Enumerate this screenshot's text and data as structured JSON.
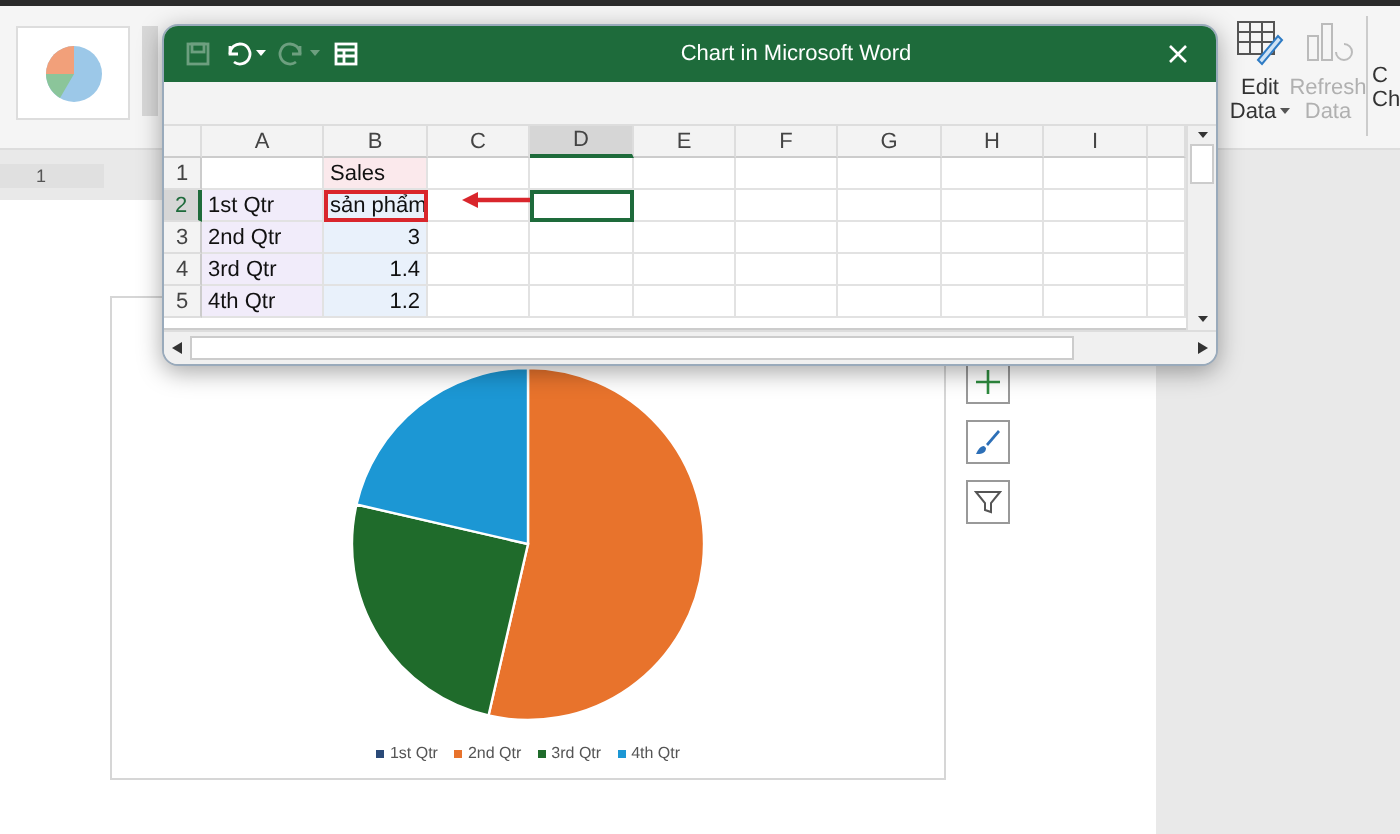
{
  "ribbon": {
    "buttons": [
      {
        "kind": "edit",
        "lines": [
          "Edit",
          "Data"
        ],
        "menu": true,
        "disabled": false
      },
      {
        "kind": "refresh",
        "lines": [
          "Refresh",
          "Data"
        ],
        "menu": false,
        "disabled": true
      },
      {
        "kind": "cut",
        "lines": [
          "C",
          "Ch"
        ],
        "menu": false,
        "disabled": false
      }
    ]
  },
  "ruler": {
    "mark": "1"
  },
  "excel": {
    "title": "Chart in Microsoft Word",
    "quick_access": [
      {
        "kind": "save",
        "disabled": true
      },
      {
        "kind": "undo",
        "disabled": false
      },
      {
        "kind": "redo",
        "disabled": true
      },
      {
        "kind": "table",
        "disabled": false
      }
    ],
    "columns": [
      {
        "label": "A",
        "selected": false
      },
      {
        "label": "B",
        "selected": false
      },
      {
        "label": "C",
        "selected": false
      },
      {
        "label": "D",
        "selected": true
      },
      {
        "label": "E",
        "selected": false
      },
      {
        "label": "F",
        "selected": false
      },
      {
        "label": "G",
        "selected": false
      },
      {
        "label": "H",
        "selected": false
      },
      {
        "label": "I",
        "selected": false
      }
    ],
    "rows": [
      {
        "number": "1",
        "active": false,
        "cells": [
          null,
          {
            "text": "Sales",
            "kind": "text",
            "marked": false
          }
        ]
      },
      {
        "number": "2",
        "active": true,
        "cells": [
          {
            "text": "1st Qtr",
            "kind": "text",
            "marked": false
          },
          {
            "text": "sản phẩm",
            "kind": "text",
            "marked": true
          }
        ]
      },
      {
        "number": "3",
        "active": false,
        "cells": [
          {
            "text": "2nd Qtr",
            "kind": "text",
            "marked": false
          },
          {
            "text": "3",
            "kind": "number",
            "marked": false
          }
        ]
      },
      {
        "number": "4",
        "active": false,
        "cells": [
          {
            "text": "3rd Qtr",
            "kind": "text",
            "marked": false
          },
          {
            "text": "1.4",
            "kind": "number",
            "marked": false
          }
        ]
      },
      {
        "number": "5",
        "active": false,
        "cells": [
          {
            "text": "4th Qtr",
            "kind": "text",
            "marked": false
          },
          {
            "text": "1.2",
            "kind": "number",
            "marked": false
          }
        ]
      }
    ]
  },
  "chart": {
    "chart_data": {
      "type": "pie",
      "categories": [
        "1st Qtr",
        "2nd Qtr",
        "3rd Qtr",
        "4th Qtr"
      ],
      "values": [
        0,
        53.6,
        25,
        21.4
      ]
    },
    "slices": [
      {
        "color": "#2a4a78"
      },
      {
        "color": "#e8732c"
      },
      {
        "color": "#1f6b2b"
      },
      {
        "color": "#1c97d4"
      }
    ],
    "tools": [
      {
        "kind": "plus"
      },
      {
        "kind": "brush"
      },
      {
        "kind": "filter"
      }
    ]
  }
}
